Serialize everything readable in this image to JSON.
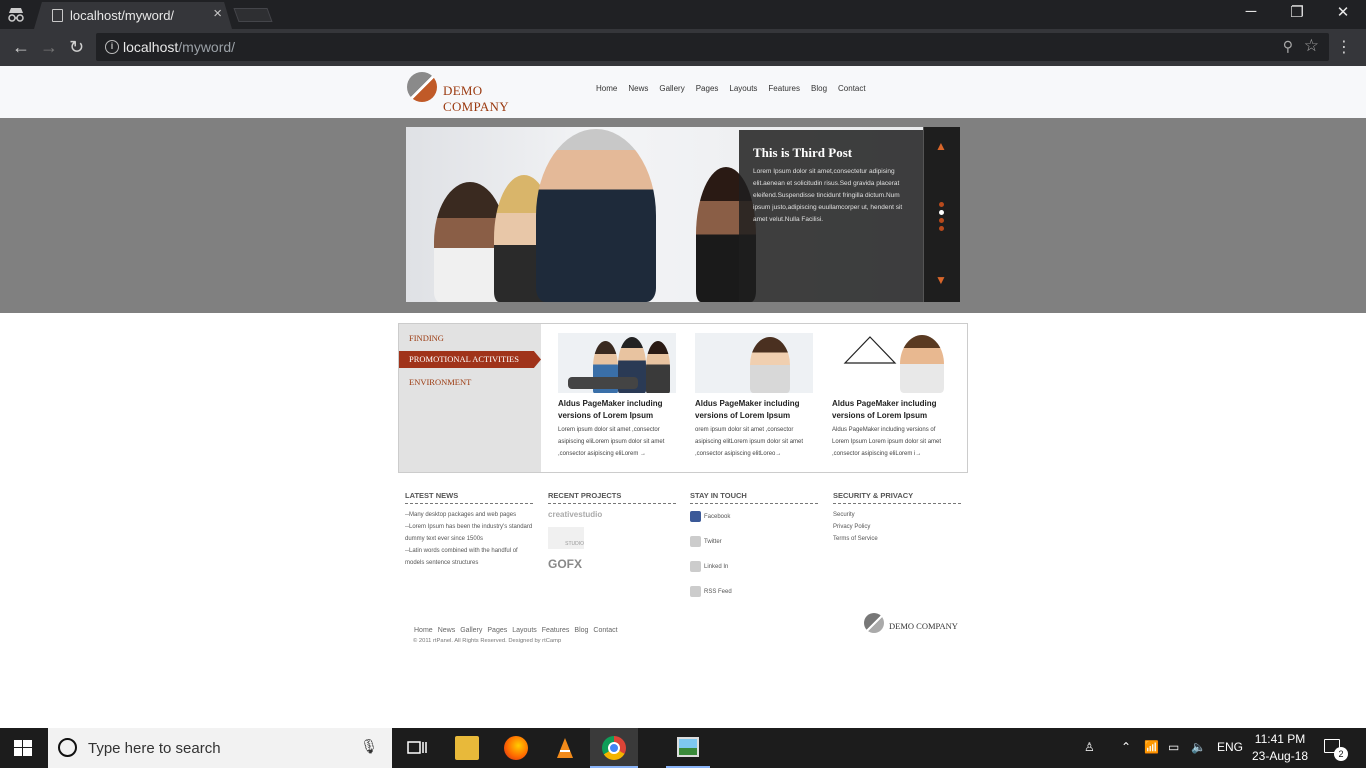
{
  "browser": {
    "tab_title": "localhost/myword/",
    "tab_close": "×",
    "url_host": "localhost",
    "url_path": "/myword/",
    "icons": [
      "incognito-icon",
      "page-icon",
      "back-icon",
      "forward-icon",
      "reload-icon",
      "info-icon",
      "zoom-icon",
      "star-icon",
      "menu-icon",
      "minimize-icon",
      "restore-icon",
      "close-icon"
    ]
  },
  "site": {
    "logo_name": "DEMO COMPANY",
    "nav": [
      "Home",
      "News",
      "Gallery",
      "Pages",
      "Layouts",
      "Features",
      "Blog",
      "Contact"
    ],
    "slider": {
      "title": "This is Third Post",
      "body": "Lorem Ipsum dolor sit amet,consectetur adipising elit.aenean et solicitudin risus.Sed gravida placerat eleifend.Suspendisse tincidunt fringilla dictum.Num ipsum justo,adipiscing euullamcorper ut, hendent sit amet velut.Nulla Facilisi."
    },
    "tabs": [
      "FINDING",
      "PROMOTIONAL ACTIVITIES",
      "ENVIRONMENT"
    ],
    "cards": [
      {
        "title": "Aldus PageMaker including versions of Lorem Ipsum",
        "desc": "Lorem ipsum dolor sit amet ,consector asipiscing eliLorem ipsum dolor sit amet ,consector asipiscing eliLorem →"
      },
      {
        "title": "Aldus PageMaker including versions of Lorem Ipsum",
        "desc": "orem ipsum dolor sit amet ,consector asipiscing elitLorem ipsum dolor sit amet ,consector asipiscing elitLoreo→"
      },
      {
        "title": "Aldus PageMaker including versions of Lorem Ipsum",
        "desc": "Aldus PageMaker including versions of Lorem Ipsum Lorem ipsum dolor sit amet ,consector asipiscing eliLorem i→"
      }
    ],
    "footer": {
      "latest_news_title": "LATEST NEWS",
      "latest_news": [
        "--Many desktop packages and web pages",
        "--Lorem Ipsum has been the industry's standard dummy text ever since 1500s",
        "--Latin words combined with the handful of models sentence structures"
      ],
      "projects_title": "RECENT PROJECTS",
      "projects": [
        "creativestudio",
        "STUDIO",
        "GOFX"
      ],
      "touch_title": "STAY IN TOUCH",
      "touch": [
        "Facebook",
        "Twitter",
        "Linked In",
        "RSS Feed"
      ],
      "security_title": "SECURITY & PRIVACY",
      "security": [
        "Security",
        "Privacy Policy",
        "Terms of Service"
      ],
      "bottom_links": [
        "Home",
        "News",
        "Gallery",
        "Pages",
        "Layouts",
        "Features",
        "Blog",
        "Contact"
      ],
      "copyright": "© 2011 rtPanel. All Rights Reserved. Designed by rtCamp",
      "logo_name": "DEMO COMPANY"
    }
  },
  "taskbar": {
    "search_placeholder": "Type here to search",
    "lang": "ENG",
    "time": "11:41 PM",
    "date": "23-Aug-18",
    "notif_count": "2"
  }
}
